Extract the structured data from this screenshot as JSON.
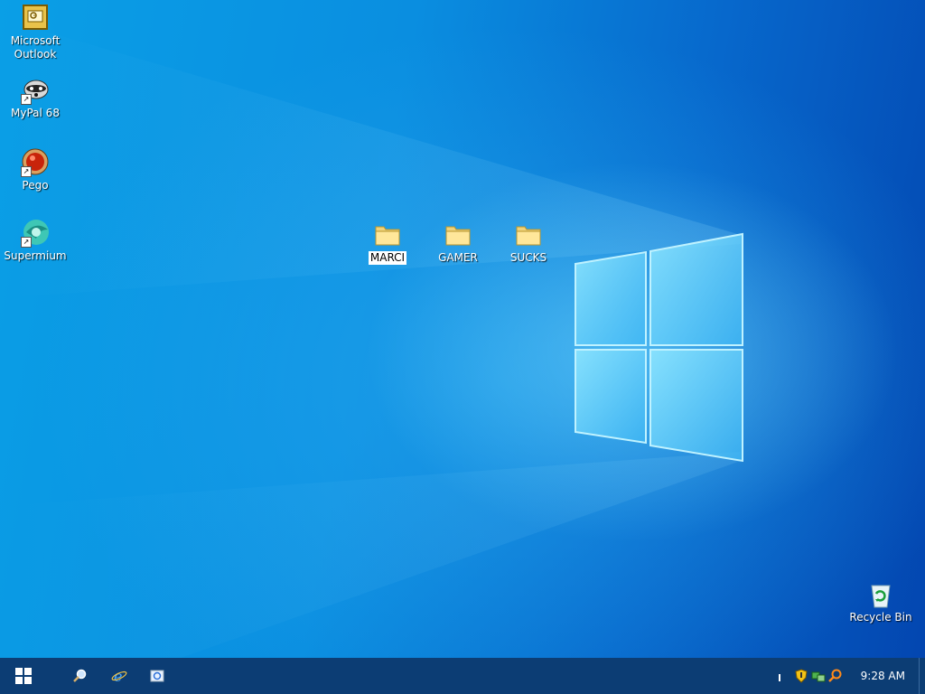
{
  "desktop": {
    "icons_left": [
      {
        "label": "Microsoft\nOutlook",
        "icon": "outlook-icon"
      },
      {
        "label": "MyPal 68",
        "icon": "raccoon-browser-icon"
      },
      {
        "label": "Pego",
        "icon": "pego-red-ball-icon"
      },
      {
        "label": "Supermium",
        "icon": "supermium-browser-icon"
      }
    ],
    "folders": [
      {
        "label": "MARCI",
        "icon": "folder-icon",
        "selected": true
      },
      {
        "label": "GAMER",
        "icon": "folder-icon"
      },
      {
        "label": "SUCKS",
        "icon": "folder-icon"
      }
    ],
    "recycle_bin": {
      "label": "Recycle Bin",
      "icon": "recycle-bin-icon"
    }
  },
  "taskbar": {
    "start_icon": "windows-logo-icon",
    "quick_launch": [
      "search-icon",
      "internet-explorer-icon",
      "outlook-express-icon"
    ],
    "tray_icons": [
      "tray-indicator-icon",
      "security-shield-icon",
      "network-icon",
      "search-tray-icon"
    ],
    "clock": "9:28 AM"
  },
  "colors": {
    "taskbar": "#0c3d74",
    "desktop_accent": "#0a9fe6"
  }
}
